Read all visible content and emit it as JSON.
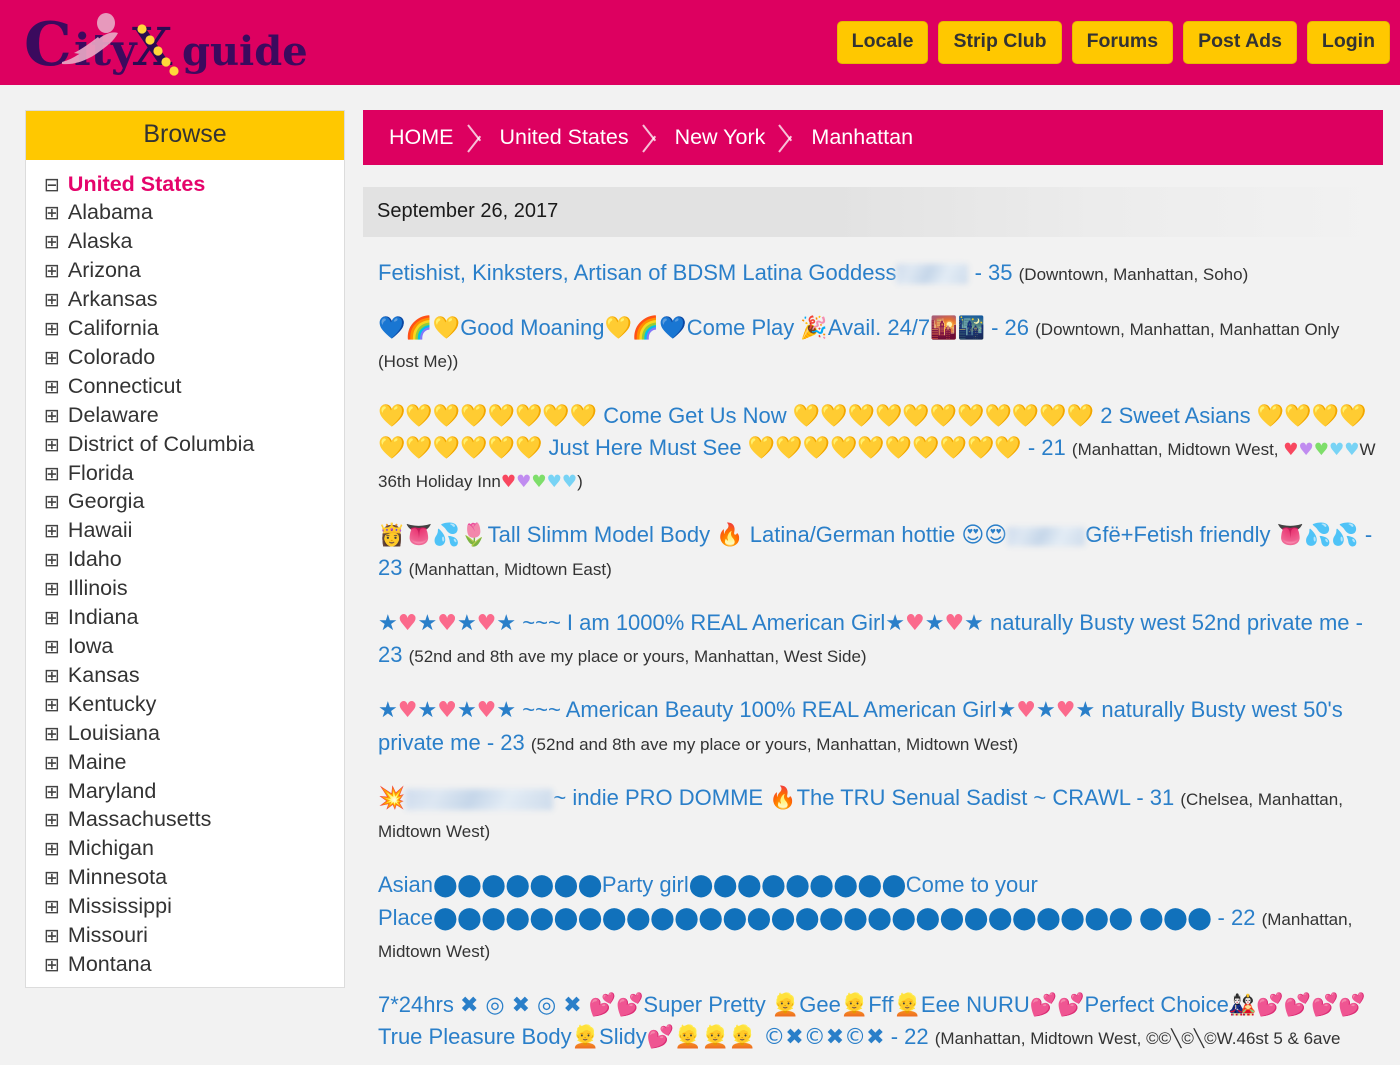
{
  "header": {
    "logo_text": "CityXguide",
    "logo_alt": "cityxguide-logo",
    "background_color": "#dd0060",
    "buttons": [
      {
        "label": "Locale",
        "name": "locale"
      },
      {
        "label": "Strip Club",
        "name": "strip-club"
      },
      {
        "label": "Forums",
        "name": "forums"
      },
      {
        "label": "Post Ads",
        "name": "post-ads"
      },
      {
        "label": "Login",
        "name": "login"
      }
    ],
    "button_color": "#ffc800"
  },
  "sidebar": {
    "title": "Browse",
    "title_color": "#ffc800",
    "root": {
      "label": "United States",
      "toggle": "⊟",
      "expanded": true,
      "color": "#e5046b"
    },
    "items": [
      {
        "label": "Alabama",
        "toggle": "⊞"
      },
      {
        "label": "Alaska",
        "toggle": "⊞"
      },
      {
        "label": "Arizona",
        "toggle": "⊞"
      },
      {
        "label": "Arkansas",
        "toggle": "⊞"
      },
      {
        "label": "California",
        "toggle": "⊞"
      },
      {
        "label": "Colorado",
        "toggle": "⊞"
      },
      {
        "label": "Connecticut",
        "toggle": "⊞"
      },
      {
        "label": "Delaware",
        "toggle": "⊞"
      },
      {
        "label": "District of Columbia",
        "toggle": "⊞"
      },
      {
        "label": "Florida",
        "toggle": "⊞"
      },
      {
        "label": "Georgia",
        "toggle": "⊞"
      },
      {
        "label": "Hawaii",
        "toggle": "⊞"
      },
      {
        "label": "Idaho",
        "toggle": "⊞"
      },
      {
        "label": "Illinois",
        "toggle": "⊞"
      },
      {
        "label": "Indiana",
        "toggle": "⊞"
      },
      {
        "label": "Iowa",
        "toggle": "⊞"
      },
      {
        "label": "Kansas",
        "toggle": "⊞"
      },
      {
        "label": "Kentucky",
        "toggle": "⊞"
      },
      {
        "label": "Louisiana",
        "toggle": "⊞"
      },
      {
        "label": "Maine",
        "toggle": "⊞"
      },
      {
        "label": "Maryland",
        "toggle": "⊞"
      },
      {
        "label": "Massachusetts",
        "toggle": "⊞"
      },
      {
        "label": "Michigan",
        "toggle": "⊞"
      },
      {
        "label": "Minnesota",
        "toggle": "⊞"
      },
      {
        "label": "Mississippi",
        "toggle": "⊞"
      },
      {
        "label": "Missouri",
        "toggle": "⊞"
      },
      {
        "label": "Montana",
        "toggle": "⊞"
      }
    ]
  },
  "breadcrumb": {
    "items": [
      "HOME",
      "United States",
      "New York",
      "Manhattan"
    ]
  },
  "main": {
    "date_header": "September 26, 2017",
    "link_color": "#2a7fc9",
    "listings": [
      {
        "id": "listing-1",
        "title_prefix": "Fetishist, Kinksters, Artisan of BDSM Latina Goddess",
        "has_blur": true,
        "age": "- 35",
        "location": "(Downtown, Manhattan, Soho)"
      },
      {
        "id": "listing-2",
        "emoji_lead": "💙🌈💛",
        "text_a": "Good Moaning",
        "emoji_mid": "💛🌈💙",
        "text_b": "Come Play",
        "emoji_b": "🎉",
        "text_c": "Avail. 24/7",
        "emoji_c": "🌇🌃",
        "age": "- 26",
        "location": "(Downtown, Manhattan, Manhattan Only (Host Me))"
      },
      {
        "id": "listing-3",
        "hearts_1": "💛💛💛💛💛💛💛💛",
        "text_a": "Come Get Us Now",
        "hearts_2": "💛💛💛💛💛💛💛💛💛💛💛",
        "text_b": "2 Sweet Asians",
        "hearts_3": "💛💛💛💛💛💛💛💛💛💛",
        "text_c": "Just Here Must See",
        "hearts_4": "💛💛💛💛💛💛💛💛💛💛",
        "age": "- 21",
        "loc_a": "(Manhattan, Midtown West,",
        "loc_hearts_1": "♥♥♥♥♥",
        "loc_b": "W 36th Holiday Inn",
        "loc_hearts_2": "♥♥♥♥♥",
        "loc_c": ")"
      },
      {
        "id": "listing-4",
        "emoji_lead": "👸👅💦🌷",
        "text_a": "Tall Slimm Model Body",
        "emoji_b": "🔥",
        "text_b": "Latina/German hottie",
        "emoji_c": "😍😍",
        "has_blur": true,
        "text_c": "Gfë+Fetish friendly",
        "emoji_d": "👅💦💦",
        "age": "- 23",
        "location": "(Manhattan, Midtown East)"
      },
      {
        "id": "listing-5",
        "stars_1": "★♥★♥★♥★",
        "text_a": "~~~ I am 1000% REAL American Girl",
        "stars_2": "★♥★♥★",
        "text_b": "naturally Busty west 52nd private me",
        "age": "- 23",
        "location": "(52nd and 8th ave my place or yours, Manhattan, West Side)"
      },
      {
        "id": "listing-6",
        "stars_1": "★♥★♥★♥★",
        "text_a": "~~~ American Beauty 100% REAL American Girl",
        "stars_2": "★♥★♥★",
        "text_b": "naturally Busty west 50's private me",
        "age": "- 23",
        "location": "(52nd and 8th ave my place or yours, Manhattan, Midtown West)"
      },
      {
        "id": "listing-7",
        "emoji_lead": "💥",
        "has_blur": true,
        "blur_hint": "Domina",
        "text_a": "~ indie PRO DOMME",
        "emoji_b": "🔥",
        "text_b": "The TRU Senual Sadist ~ CRAWL",
        "age": "- 31",
        "location": "(Chelsea, Manhattan, Midtown West)"
      },
      {
        "id": "listing-8",
        "text_a": "Asian",
        "dots_1": "⬤⬤⬤⬤⬤⬤⬤",
        "text_b": "Party girl",
        "dots_2": "⬤⬤⬤⬤⬤⬤⬤⬤⬤",
        "text_c": "Come to your Place",
        "dots_3": "⬤⬤⬤⬤⬤⬤⬤⬤⬤⬤⬤⬤⬤⬤⬤⬤⬤⬤⬤⬤⬤⬤⬤⬤⬤⬤⬤⬤⬤ ⬤⬤⬤",
        "age": "- 22",
        "location": "(Manhattan, Midtown West)"
      },
      {
        "id": "listing-9",
        "text_a": "7*24hrs",
        "emoji_a": "✖ ◎ ✖ ◎ ✖ 💕💕",
        "text_b": "Super Pretty",
        "emoji_b": "👱",
        "text_c": "Gee",
        "emoji_c": "👱",
        "text_d": "Fff",
        "emoji_d": "👱",
        "text_e": "Eee NURU",
        "emoji_e": "💕💕",
        "text_f": "Perfect Choice",
        "emoji_f": "🎎💕💕💕💕",
        "text_g": "True Pleasure Body",
        "emoji_g": "👱",
        "text_h": "Slidy",
        "emoji_h": "💕👱👱👱 ©✖©✖©✖",
        "age": "- 22",
        "location": "(Manhattan, Midtown West, ©©╲©╲©W.46st 5 & 6ave"
      }
    ]
  }
}
